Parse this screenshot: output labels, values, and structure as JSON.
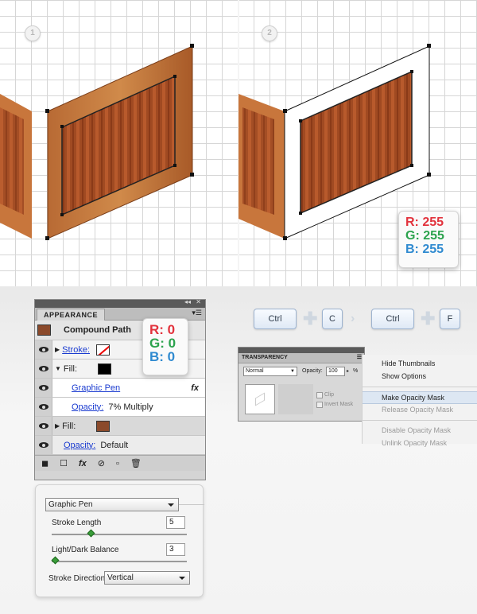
{
  "steps": [
    "1",
    "2"
  ],
  "rgb_white": {
    "r": "R: 255",
    "g": "G: 255",
    "b": "B: 255"
  },
  "rgb_black": {
    "r": "R: 0",
    "g": "G: 0",
    "b": "B: 0"
  },
  "appearance": {
    "tab": "APPEARANCE",
    "header": "Compound Path",
    "rows": [
      {
        "label": "Stroke:",
        "kind": "stroke"
      },
      {
        "label": "Fill:",
        "kind": "fill_black"
      },
      {
        "label": "Graphic Pen",
        "kind": "effect",
        "fx": "fx"
      },
      {
        "label": "Opacity:",
        "value": "7% Multiply",
        "kind": "opacity"
      },
      {
        "label": "Fill:",
        "kind": "fill_brown"
      },
      {
        "label": "Opacity:",
        "value": "Default",
        "kind": "opacity2"
      }
    ]
  },
  "shortcut": {
    "key1": "Ctrl",
    "key2": "C",
    "key3": "Ctrl",
    "key4": "F"
  },
  "transparency": {
    "title": "TRANSPARENCY",
    "mode": "Normal",
    "opacity_label": "Opacity:",
    "opacity_value": "100",
    "pct": "%",
    "clip": "Clip",
    "invert": "Invert Mask"
  },
  "menu": {
    "items": [
      "Hide Thumbnails",
      "Show Options",
      "Make Opacity Mask",
      "Release Opacity Mask",
      "Disable Opacity Mask",
      "Unlink Opacity Mask"
    ]
  },
  "graphic_pen": {
    "select": "Graphic Pen",
    "stroke_length_label": "Stroke Length",
    "stroke_length": "5",
    "balance_label": "Light/Dark Balance",
    "balance": "3",
    "direction_label": "Stroke Direction:",
    "direction": "Vertical"
  },
  "colors": {
    "wood": "#a85a28",
    "fill_brown": "#8b4a2b",
    "accent_red": "#e2323c",
    "accent_green": "#2ca34e",
    "accent_blue": "#2f8ad0"
  }
}
